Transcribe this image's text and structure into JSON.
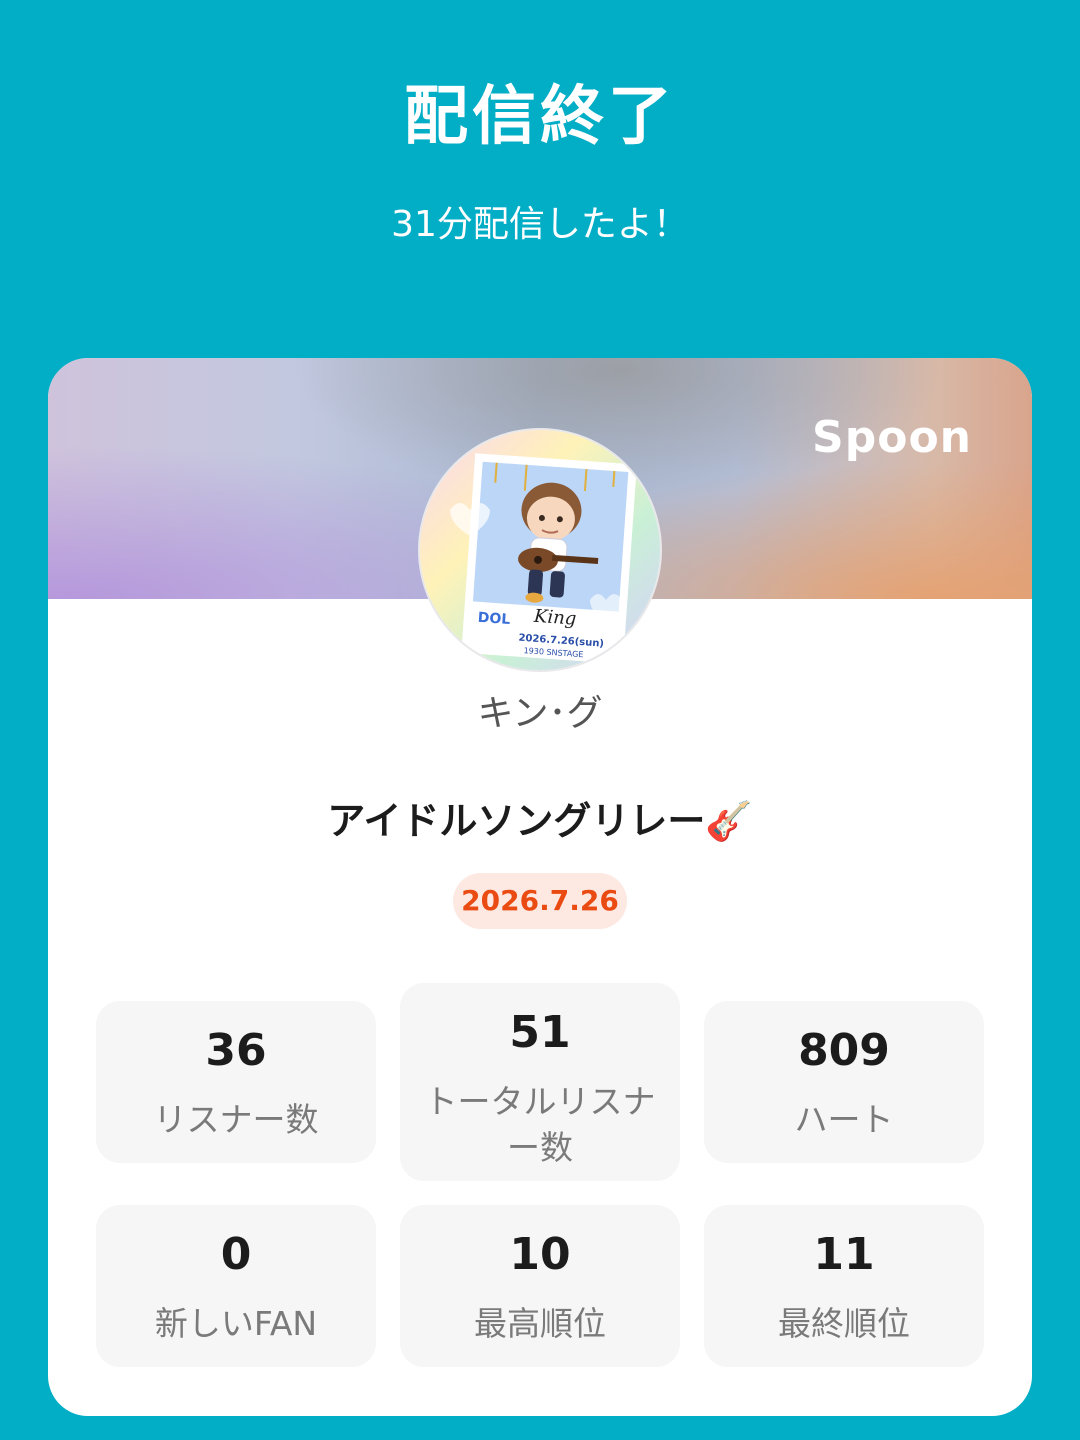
{
  "header": {
    "title": "配信終了",
    "subtitle": "31分配信したよ！"
  },
  "card": {
    "brand": "Spoon",
    "avatar_icon": "dj-avatar-illustration",
    "username": "キン･グ",
    "live_title": "アイドルソングリレー🎸",
    "date": "2026.7.26",
    "stats": [
      {
        "value": "36",
        "label": "リスナー数"
      },
      {
        "value": "51",
        "label": "トータルリスナー数"
      },
      {
        "value": "809",
        "label": "ハート"
      },
      {
        "value": "0",
        "label": "新しいFAN"
      },
      {
        "value": "10",
        "label": "最高順位"
      },
      {
        "value": "11",
        "label": "最終順位"
      }
    ]
  },
  "colors": {
    "background": "#02adc6",
    "date_text": "#ea4b12",
    "date_bg": "#fde8e2"
  }
}
